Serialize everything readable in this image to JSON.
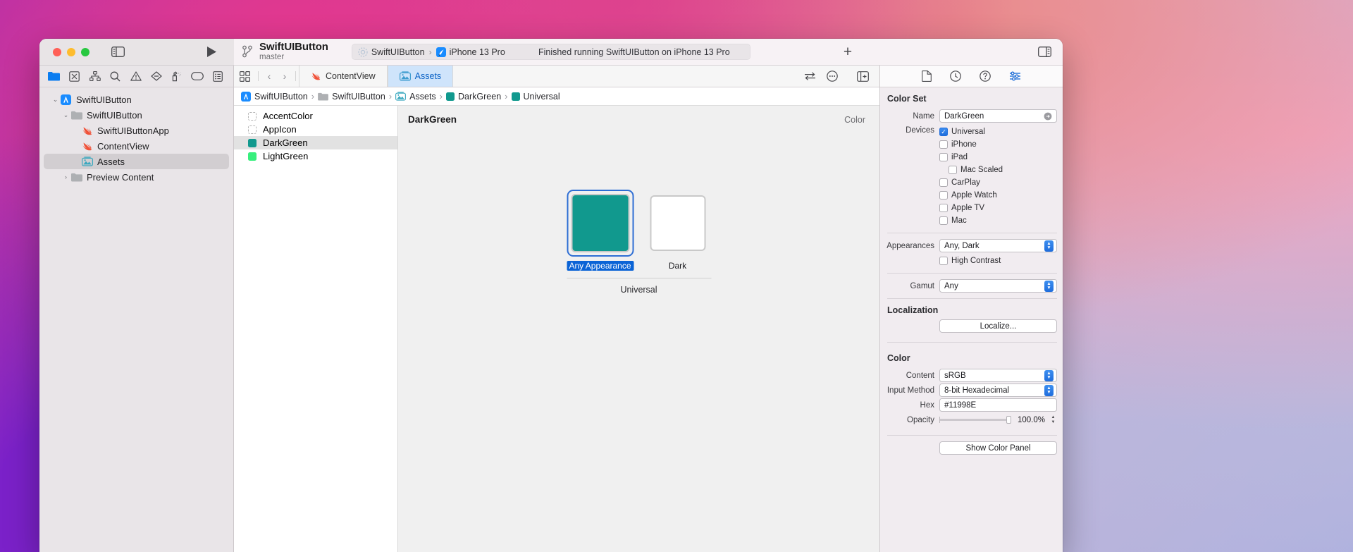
{
  "window": {
    "traffic_lights": [
      "close",
      "minimize",
      "zoom"
    ],
    "sidebar_toggle": "sidebar-toggle-icon",
    "run_button": "run-icon",
    "add_button": "+"
  },
  "scheme": {
    "name": "SwiftUIButton",
    "branch": "master"
  },
  "status": {
    "scheme": "SwiftUIButton",
    "chevron": "›",
    "destination": "iPhone 13 Pro",
    "message": "Finished running SwiftUIButton on iPhone 13 Pro"
  },
  "navigator": {
    "toolbar_icons": [
      "folder-icon",
      "source-control-icon",
      "hierarchy-icon",
      "search-icon",
      "warning-icon",
      "breakpoint-icon",
      "debug-icon",
      "tag-icon",
      "report-icon"
    ],
    "items": [
      {
        "label": "SwiftUIButton",
        "icon": "xcode-project-icon",
        "twisty": "⌄",
        "depth": 0,
        "selected": false
      },
      {
        "label": "SwiftUIButton",
        "icon": "folder-icon",
        "twisty": "⌄",
        "depth": 1,
        "selected": false
      },
      {
        "label": "SwiftUIButtonApp",
        "icon": "swift-file-icon",
        "twisty": "",
        "depth": 2,
        "selected": false
      },
      {
        "label": "ContentView",
        "icon": "swift-file-icon",
        "twisty": "",
        "depth": 2,
        "selected": false
      },
      {
        "label": "Assets",
        "icon": "assets-icon",
        "twisty": "",
        "depth": 2,
        "selected": true
      },
      {
        "label": "Preview Content",
        "icon": "folder-icon",
        "twisty": "›",
        "depth": 1,
        "selected": false
      }
    ]
  },
  "editor": {
    "tabs": [
      {
        "label": "ContentView",
        "icon": "swift-file-icon",
        "active": false
      },
      {
        "label": "Assets",
        "icon": "assets-icon",
        "active": true
      }
    ],
    "back_arrow": "‹",
    "forward_arrow": "›",
    "right_icons": [
      "swap-editor-icon",
      "more-options-icon",
      "add-editor-icon"
    ],
    "breadcrumb": [
      {
        "label": "SwiftUIButton",
        "icon": "xcode-project-icon"
      },
      {
        "label": "SwiftUIButton",
        "icon": "folder-icon"
      },
      {
        "label": "Assets",
        "icon": "assets-icon"
      },
      {
        "label": "DarkGreen",
        "icon": "color-swatch-icon"
      },
      {
        "label": "Universal",
        "icon": "color-swatch-icon"
      }
    ],
    "breadcrumb_sep": "›"
  },
  "asset_list": [
    {
      "label": "AccentColor",
      "type": "empty",
      "color": "",
      "selected": false
    },
    {
      "label": "AppIcon",
      "type": "empty",
      "color": "",
      "selected": false
    },
    {
      "label": "DarkGreen",
      "type": "color",
      "color": "#11998E",
      "selected": true
    },
    {
      "label": "LightGreen",
      "type": "color",
      "color": "#38EF7D",
      "selected": false
    }
  ],
  "canvas": {
    "title": "DarkGreen",
    "kind": "Color",
    "group_label": "Universal",
    "swatches": [
      {
        "label": "Any Appearance",
        "color": "#11998E",
        "selected": true
      },
      {
        "label": "Dark",
        "color": "#FFFFFF",
        "selected": false
      }
    ]
  },
  "inspector": {
    "tab_icons": [
      "file-inspector-icon",
      "history-inspector-icon",
      "help-inspector-icon",
      "attributes-inspector-icon"
    ],
    "color_set": {
      "section_title": "Color Set",
      "name_label": "Name",
      "name_value": "DarkGreen",
      "devices_label": "Devices",
      "devices": [
        {
          "label": "Universal",
          "checked": true,
          "indent": false
        },
        {
          "label": "iPhone",
          "checked": false,
          "indent": false
        },
        {
          "label": "iPad",
          "checked": false,
          "indent": false
        },
        {
          "label": "Mac Scaled",
          "checked": false,
          "indent": true
        },
        {
          "label": "CarPlay",
          "checked": false,
          "indent": false
        },
        {
          "label": "Apple Watch",
          "checked": false,
          "indent": false
        },
        {
          "label": "Apple TV",
          "checked": false,
          "indent": false
        },
        {
          "label": "Mac",
          "checked": false,
          "indent": false
        }
      ],
      "appearances_label": "Appearances",
      "appearances_value": "Any, Dark",
      "high_contrast_label": "High Contrast",
      "high_contrast_checked": false,
      "gamut_label": "Gamut",
      "gamut_value": "Any",
      "localization_label": "Localization",
      "localize_button": "Localize..."
    },
    "color": {
      "section_title": "Color",
      "content_label": "Content",
      "content_value": "sRGB",
      "input_method_label": "Input Method",
      "input_method_value": "8-bit Hexadecimal",
      "hex_label": "Hex",
      "hex_value": "#11998E",
      "opacity_label": "Opacity",
      "opacity_value": "100.0%",
      "show_color_panel": "Show Color Panel"
    }
  },
  "colors": {
    "accent_blue": "#0a63d6",
    "dark_green": "#11998E",
    "light_green": "#38EF7D",
    "selection_grey": "#d2ced1"
  }
}
